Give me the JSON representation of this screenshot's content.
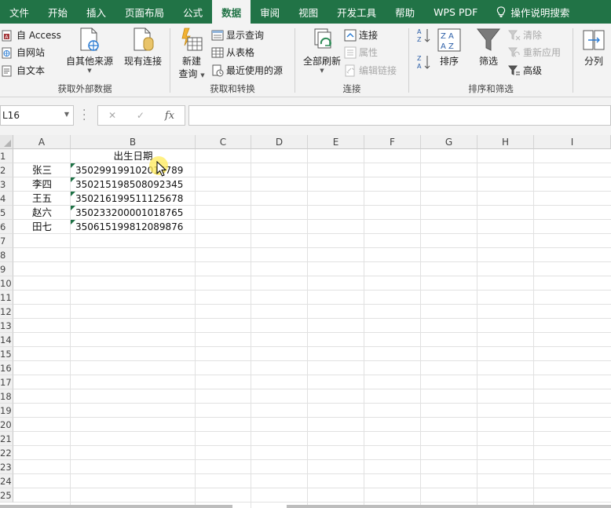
{
  "menu": {
    "tabs": [
      "文件",
      "开始",
      "插入",
      "页面布局",
      "公式",
      "数据",
      "审阅",
      "视图",
      "开发工具",
      "帮助",
      "WPS PDF"
    ],
    "active_index": 5,
    "search_label": "操作说明搜索"
  },
  "ribbon": {
    "get_external": {
      "access": "自 Access",
      "web": "自网站",
      "text": "自文本",
      "other_sources": "自其他来源",
      "existing": "现有连接",
      "label": "获取外部数据"
    },
    "get_transform": {
      "new_query_line1": "新建",
      "new_query_line2": "查询",
      "show_queries": "显示查询",
      "from_table": "从表格",
      "recent_sources": "最近使用的源",
      "label": "获取和转换"
    },
    "connections": {
      "refresh_all": "全部刷新",
      "connections": "连接",
      "properties": "属性",
      "edit_links": "编辑链接",
      "label": "连接"
    },
    "sort_filter": {
      "sort": "排序",
      "filter": "筛选",
      "clear": "清除",
      "reapply": "重新应用",
      "advanced": "高级",
      "label": "排序和筛选"
    },
    "data_tools": {
      "split": "分列"
    }
  },
  "formula_bar": {
    "name_box": "L16",
    "fx": "fx",
    "value": ""
  },
  "grid": {
    "columns": [
      "A",
      "B",
      "C",
      "D",
      "E",
      "F",
      "G",
      "H",
      "I"
    ],
    "rows": [
      "1",
      "2",
      "3",
      "4",
      "5",
      "6",
      "7",
      "8",
      "9",
      "10",
      "11",
      "12",
      "13",
      "14",
      "15",
      "16",
      "17",
      "18",
      "19",
      "20",
      "21",
      "22",
      "23",
      "24",
      "25"
    ],
    "header_b1": "出生日期",
    "records": [
      {
        "name": "张三",
        "id": "350299199102016789"
      },
      {
        "name": "李四",
        "id": "350215198508092345"
      },
      {
        "name": "王五",
        "id": "350216199511125678"
      },
      {
        "name": "赵六",
        "id": "350233200001018765"
      },
      {
        "name": "田七",
        "id": "350615199812089876"
      }
    ]
  },
  "colors": {
    "accent": "#217346",
    "ribbon_bg": "#f3f3f3",
    "error_triangle": "#1e7145"
  }
}
